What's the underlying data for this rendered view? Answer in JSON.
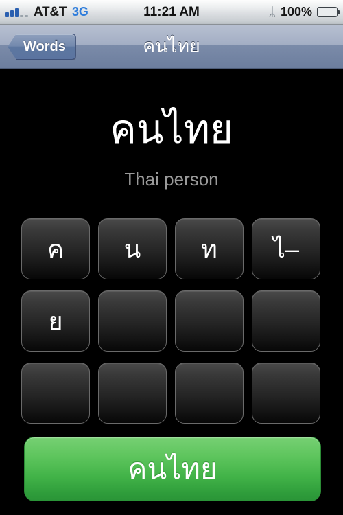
{
  "status_bar": {
    "signal_icon": "signal-bars-icon",
    "signal_bars_filled": 3,
    "signal_bars_empty": 2,
    "carrier": "AT&T",
    "network": "3G",
    "time": "11:21 AM",
    "bluetooth_icon": "bluetooth-icon",
    "bluetooth_glyph": "ᛦ",
    "battery_percent": "100%",
    "battery_icon": "battery-icon"
  },
  "nav_bar": {
    "back_label": "Words",
    "title": "คนไทย"
  },
  "main": {
    "word": "คนไทย",
    "translation": "Thai person",
    "tiles": [
      [
        {
          "label": "ค",
          "filled": true
        },
        {
          "label": "น",
          "filled": true
        },
        {
          "label": "ท",
          "filled": true
        },
        {
          "label": "ไ–",
          "filled": true
        }
      ],
      [
        {
          "label": "ย",
          "filled": true
        },
        {
          "label": "",
          "filled": false
        },
        {
          "label": "",
          "filled": false
        },
        {
          "label": "",
          "filled": false
        }
      ],
      [
        {
          "label": "",
          "filled": false
        },
        {
          "label": "",
          "filled": false
        },
        {
          "label": "",
          "filled": false
        },
        {
          "label": "",
          "filled": false
        }
      ]
    ],
    "answer_button_label": "คนไทย"
  },
  "colors": {
    "background": "#000000",
    "nav_top": "#b7c0d1",
    "nav_bottom": "#6c7e9e",
    "accent_green_top": "#76d073",
    "accent_green_bottom": "#2a9437",
    "network_blue": "#2f7ddb",
    "translation_gray": "#9a9a9a"
  }
}
